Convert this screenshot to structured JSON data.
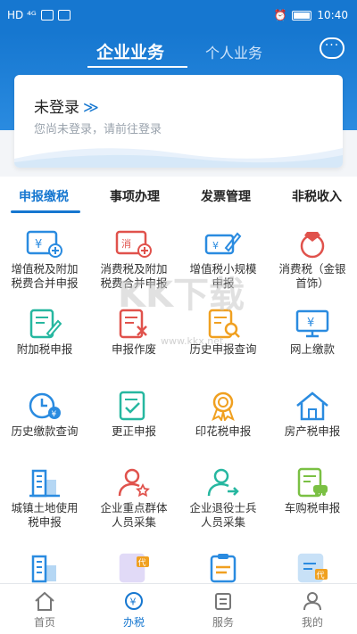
{
  "status_bar": {
    "left_text": "HD ⁴ᴳ",
    "time": "10:40"
  },
  "header": {
    "tab_corporate": "企业业务",
    "tab_personal": "个人业务",
    "chat_icon": "chat-bubble-icon"
  },
  "login_card": {
    "title": "未登录",
    "chevron": "≫",
    "subtitle": "您尚未登录，请前往登录"
  },
  "categories": {
    "tabs": [
      "申报缴税",
      "事项办理",
      "发票管理",
      "非税收入"
    ],
    "active": "申报缴税"
  },
  "grid": {
    "items": [
      {
        "line1": "增值税及附加",
        "line2": "税费合并申报",
        "icon": "invoice-yen-plus-icon",
        "color": "#2a8be0"
      },
      {
        "line1": "消费税及附加",
        "line2": "税费合并申报",
        "icon": "consumption-tax-plus-icon",
        "color": "#e0524c"
      },
      {
        "line1": "增值税小规模",
        "line2": "申报",
        "icon": "card-edit-icon",
        "color": "#2a8be0"
      },
      {
        "line1": "消费税（金银",
        "line2": "首饰）",
        "icon": "ring-gem-icon",
        "color": "#e0524c"
      },
      {
        "line1": "附加税申报",
        "line2": "",
        "icon": "doc-edit-icon",
        "color": "#26b7a0"
      },
      {
        "line1": "申报作废",
        "line2": "",
        "icon": "doc-cancel-icon",
        "color": "#e0524c"
      },
      {
        "line1": "历史申报查询",
        "line2": "",
        "icon": "doc-search-icon",
        "color": "#f0a020"
      },
      {
        "line1": "网上缴款",
        "line2": "",
        "icon": "monitor-yen-icon",
        "color": "#2a8be0"
      },
      {
        "line1": "历史缴款查询",
        "line2": "",
        "icon": "clock-yen-icon",
        "color": "#2a8be0"
      },
      {
        "line1": "更正申报",
        "line2": "",
        "icon": "doc-check-icon",
        "color": "#26b7a0"
      },
      {
        "line1": "印花税申报",
        "line2": "",
        "icon": "award-ribbon-icon",
        "color": "#f0a020"
      },
      {
        "line1": "房产税申报",
        "line2": "",
        "icon": "house-icon",
        "color": "#2a8be0"
      },
      {
        "line1": "城镇土地使用",
        "line2": "税申报",
        "icon": "buildings-icon",
        "color": "#2a8be0"
      },
      {
        "line1": "企业重点群体",
        "line2": "人员采集",
        "icon": "user-star-icon",
        "color": "#e0524c"
      },
      {
        "line1": "企业退役士兵",
        "line2": "人员采集",
        "icon": "user-arrow-icon",
        "color": "#26b7a0"
      },
      {
        "line1": "车购税申报",
        "line2": "",
        "icon": "doc-car-icon",
        "color": "#7ac043"
      },
      {
        "line1": "",
        "line2": "",
        "icon": "buildings-icon",
        "color": "#2a8be0"
      },
      {
        "line1": "",
        "line2": "",
        "icon": "doc-agent-icon",
        "color": "#8a6fe0"
      },
      {
        "line1": "",
        "line2": "",
        "icon": "clipboard-agent-icon",
        "color": "#2a8be0"
      },
      {
        "line1": "",
        "line2": "",
        "icon": "doc-agent-icon",
        "color": "#2a8be0"
      }
    ]
  },
  "watermark": {
    "text": "KK下载",
    "url": "www.kkx.net"
  },
  "bottom_nav": {
    "items": [
      {
        "label": "首页",
        "icon": "home-icon"
      },
      {
        "label": "办税",
        "icon": "tax-yen-icon"
      },
      {
        "label": "服务",
        "icon": "service-icon"
      },
      {
        "label": "我的",
        "icon": "profile-icon"
      }
    ],
    "active": "办税"
  },
  "colors": {
    "primary": "#1677d0",
    "red": "#e0524c",
    "teal": "#26b7a0",
    "orange": "#f0a020"
  }
}
